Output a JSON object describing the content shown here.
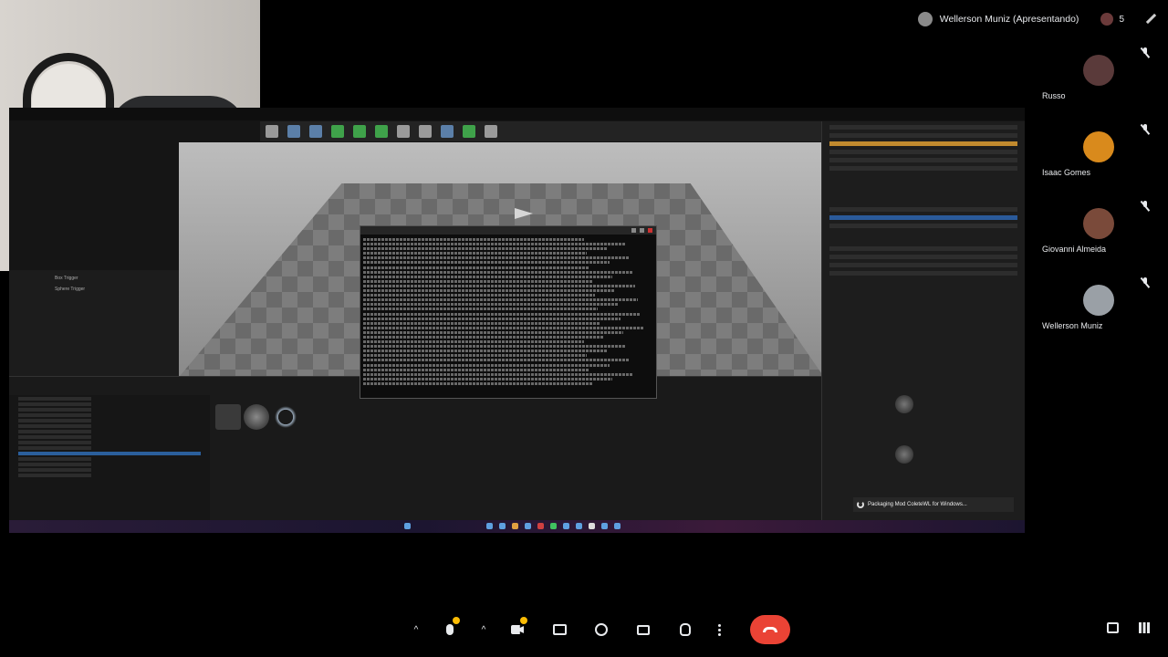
{
  "presenter": {
    "label": "Wellerson Muniz (Apresentando)",
    "people_count": "5"
  },
  "participants": [
    {
      "name": "Russo",
      "muted": true,
      "avatar_color": "#5a3a3a"
    },
    {
      "name": "Isaac Gomes",
      "muted": true,
      "avatar_color": "#d98a1c"
    },
    {
      "name": "Giovanni Almeida",
      "muted": true,
      "avatar_color": "#7a4a3a"
    },
    {
      "name": "Wellerson Muniz",
      "muted": true,
      "avatar_color": "#9aa0a6"
    }
  ],
  "shared_screen": {
    "console_log_prefix": "LogShaderCompilers: Display: Worker (1/2): shaders left to compile",
    "notification": "Packaging Mod ColeteWL for Windows...",
    "left_outliner_items": [
      "Box Trigger",
      "Sphere Trigger"
    ],
    "content_browser_path": "ColeteWL Content"
  },
  "controls": {
    "mic": "microphone",
    "camera": "camera",
    "present": "present-screen",
    "reactions": "emoji-reactions",
    "captions": "captions",
    "raise_hand": "raise-hand",
    "more": "more-options",
    "leave": "leave-call"
  },
  "colors": {
    "end_call": "#ea4335",
    "badge": "#fbbc04",
    "background": "#000000"
  }
}
